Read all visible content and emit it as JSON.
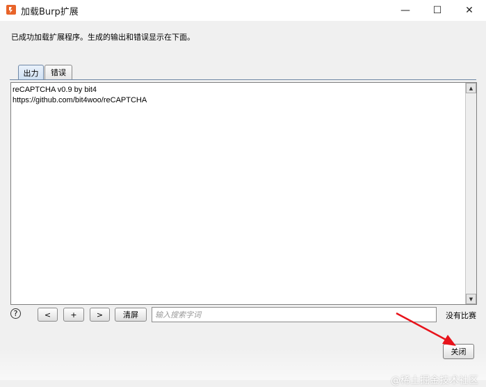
{
  "window": {
    "title": "加载Burp扩展",
    "min_glyph": "—",
    "max_glyph": "☐",
    "close_glyph": "✕"
  },
  "info_text": "已成功加载扩展程序。生成的输出和错误显示在下面。",
  "tabs": [
    {
      "label": "出力",
      "selected": true
    },
    {
      "label": "错误",
      "selected": false
    }
  ],
  "output": {
    "lines": [
      "reCAPTCHA v0.9 by bit4",
      "https://github.com/bit4woo/reCAPTCHA"
    ]
  },
  "scroll": {
    "up": "▲",
    "down": "▼"
  },
  "search": {
    "help": "?",
    "prev_label": "<",
    "plus_label": "+",
    "next_label": ">",
    "clear_label": "清屏",
    "placeholder": "输入搜索字词",
    "match_status": "没有比赛"
  },
  "close_label": "关闭",
  "watermark": "@稀土掘金技术社区",
  "colors": {
    "arrow": "#e8131b",
    "tab_selected": "#cfe0f3",
    "title_bg": "#ffffff"
  }
}
